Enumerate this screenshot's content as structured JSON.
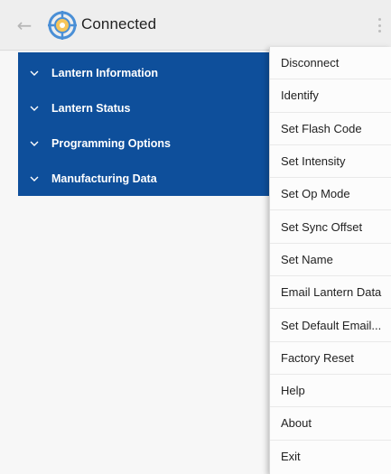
{
  "toolbar": {
    "back_icon": "arrow-left-icon",
    "logo_icon": "lantern-target-icon",
    "title": "Connected",
    "overflow_icon": "more-vert-icon"
  },
  "panel": {
    "color": "#0e4f9b",
    "groups": [
      {
        "label": "Lantern Information"
      },
      {
        "label": "Lantern Status"
      },
      {
        "label": "Programming Options"
      },
      {
        "label": "Manufacturing Data"
      }
    ]
  },
  "menu": {
    "items": [
      {
        "label": "Disconnect"
      },
      {
        "label": "Identify"
      },
      {
        "label": "Set Flash Code"
      },
      {
        "label": "Set Intensity"
      },
      {
        "label": "Set Op Mode"
      },
      {
        "label": "Set Sync Offset"
      },
      {
        "label": "Set Name"
      },
      {
        "label": "Email Lantern Data"
      },
      {
        "label": "Set Default Email..."
      },
      {
        "label": "Factory Reset"
      },
      {
        "label": "Help"
      },
      {
        "label": "About"
      },
      {
        "label": "Exit"
      }
    ]
  }
}
